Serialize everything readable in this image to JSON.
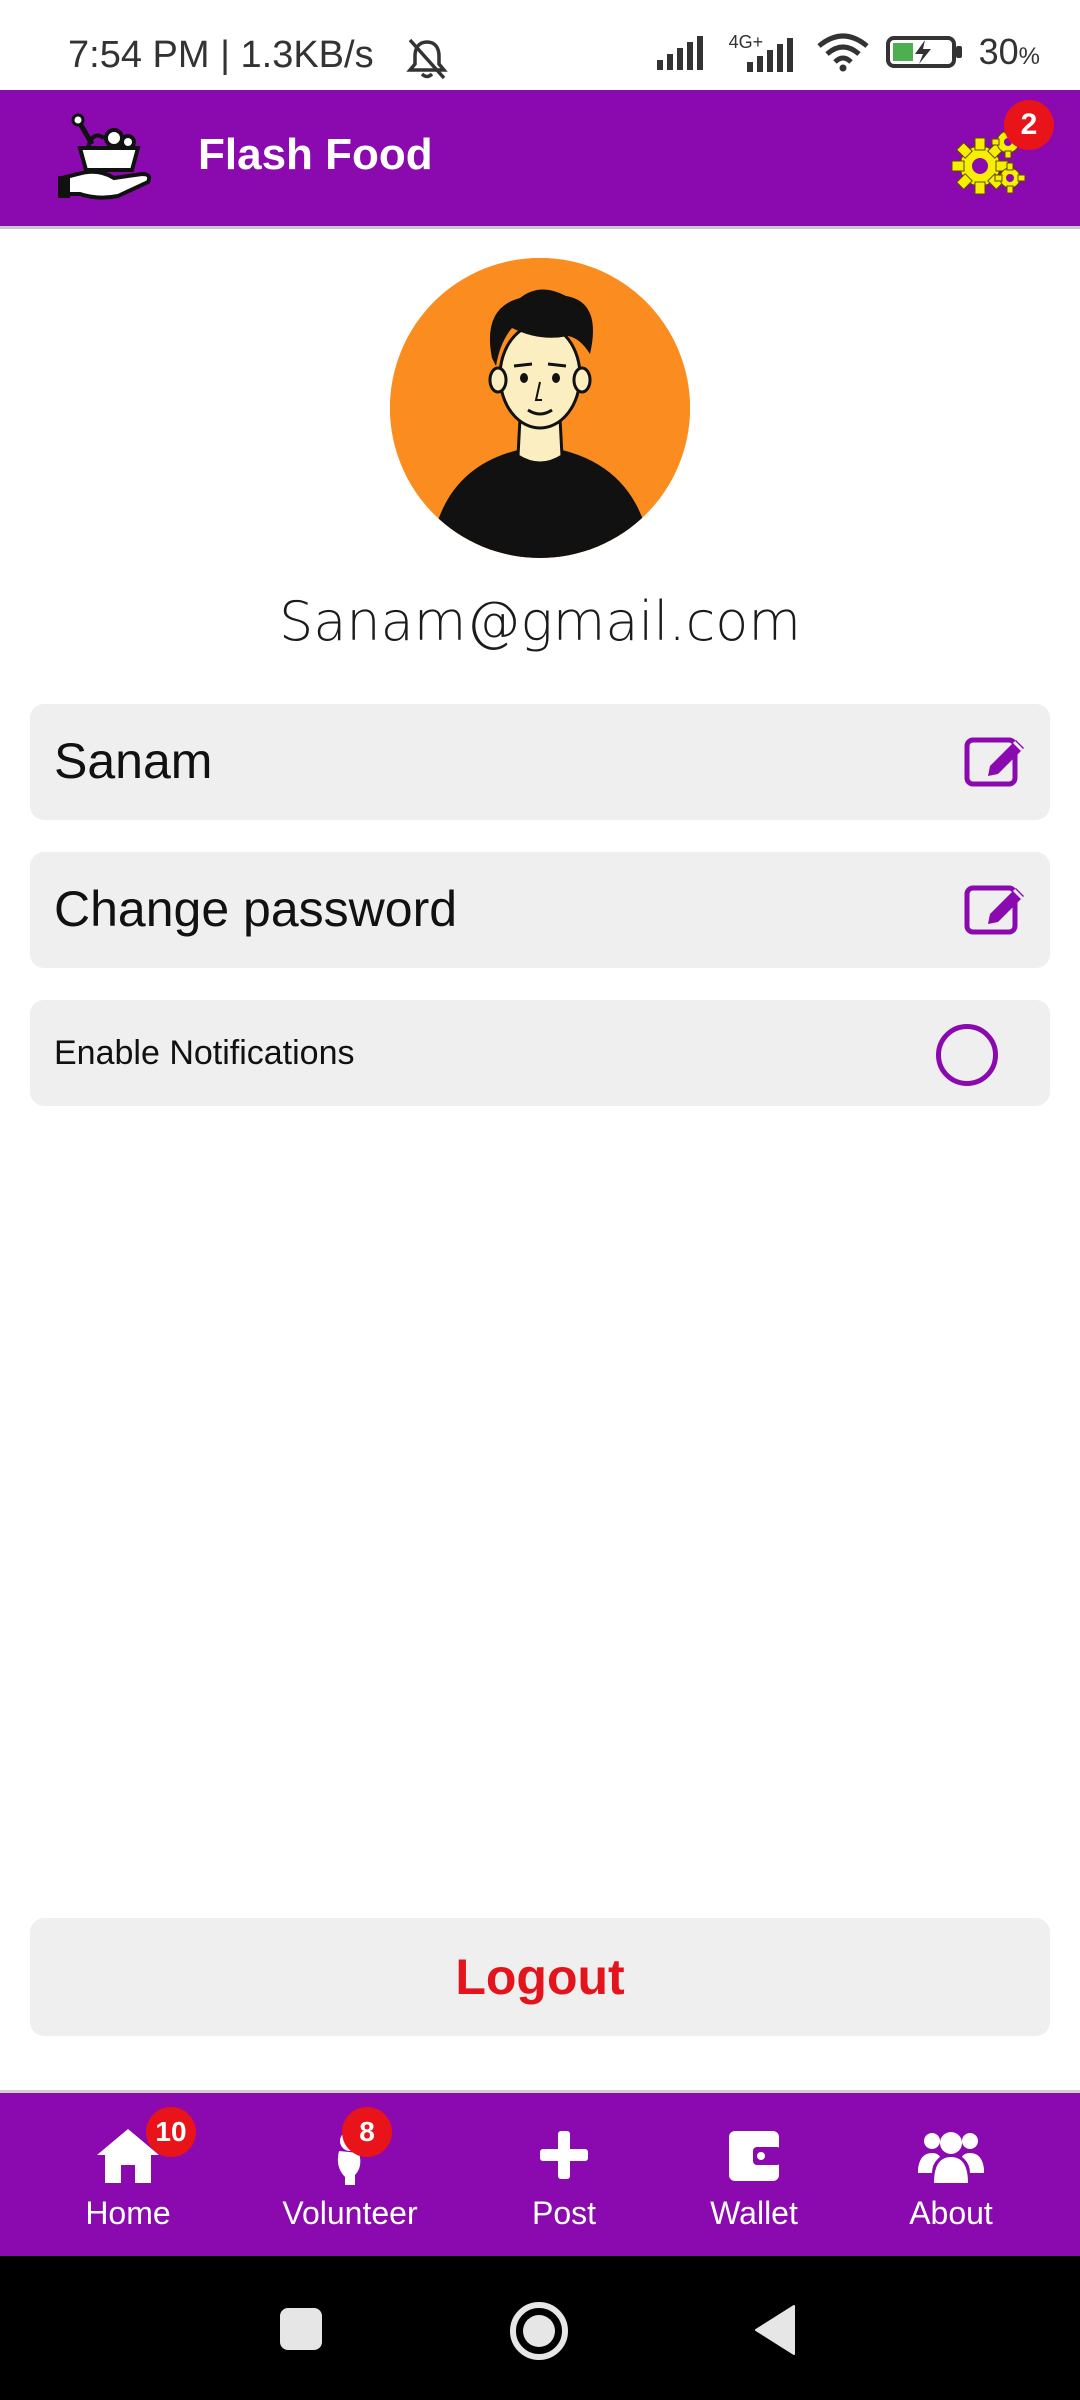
{
  "status_bar": {
    "time_text": "7:54 PM | 1.3KB/s",
    "battery_percent": "30",
    "battery_unit": "%",
    "network_label": "4G+"
  },
  "header": {
    "title": "Flash Food",
    "settings_badge": "2"
  },
  "profile": {
    "email": "Sanam@gmail.com"
  },
  "settings_list": {
    "name_value": "Sanam",
    "change_password_label": "Change password",
    "notifications_label": "Enable Notifications",
    "notifications_enabled": false
  },
  "logout_label": "Logout",
  "bottom_nav": {
    "items": [
      {
        "label": "Home",
        "icon": "home-icon",
        "badge": "10"
      },
      {
        "label": "Volunteer",
        "icon": "volunteer-icon",
        "badge": "8"
      },
      {
        "label": "Post",
        "icon": "plus-icon"
      },
      {
        "label": "Wallet",
        "icon": "wallet-icon"
      },
      {
        "label": "About",
        "icon": "users-icon"
      }
    ]
  },
  "colors": {
    "primary": "#8a0aaf",
    "badge": "#e8141a",
    "logout_text": "#e3141c",
    "settings_icon": "#ffee00",
    "avatar_bg": "#fb8c1f"
  }
}
